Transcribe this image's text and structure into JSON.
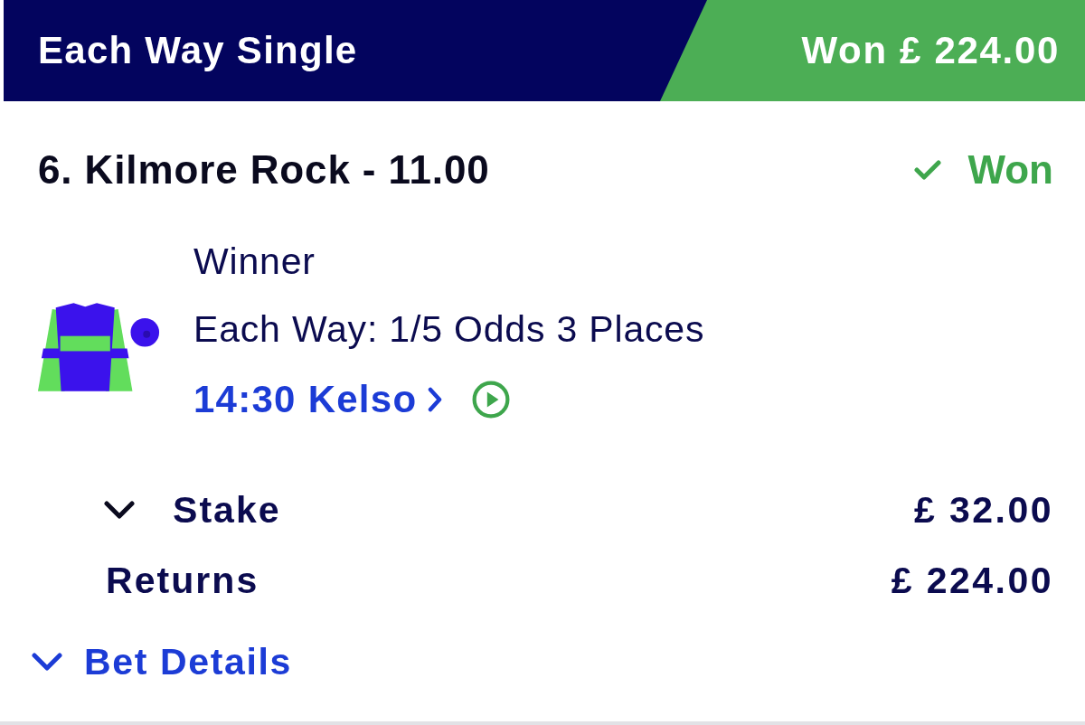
{
  "header": {
    "title": "Each Way Single",
    "result": "Won £ 224.00",
    "won": true
  },
  "selection": {
    "name": "6. Kilmore Rock - 11.00",
    "status": "Won",
    "won": true
  },
  "details": {
    "market": "Winner",
    "terms": "Each Way: 1/5 Odds 3 Places",
    "race_link": "14:30 Kelso"
  },
  "stake": {
    "label": "Stake",
    "value": "£ 32.00",
    "expanded": false
  },
  "returns": {
    "label": "Returns",
    "value": "£ 224.00"
  },
  "bet_details": {
    "label": "Bet Details",
    "expanded": false
  }
}
